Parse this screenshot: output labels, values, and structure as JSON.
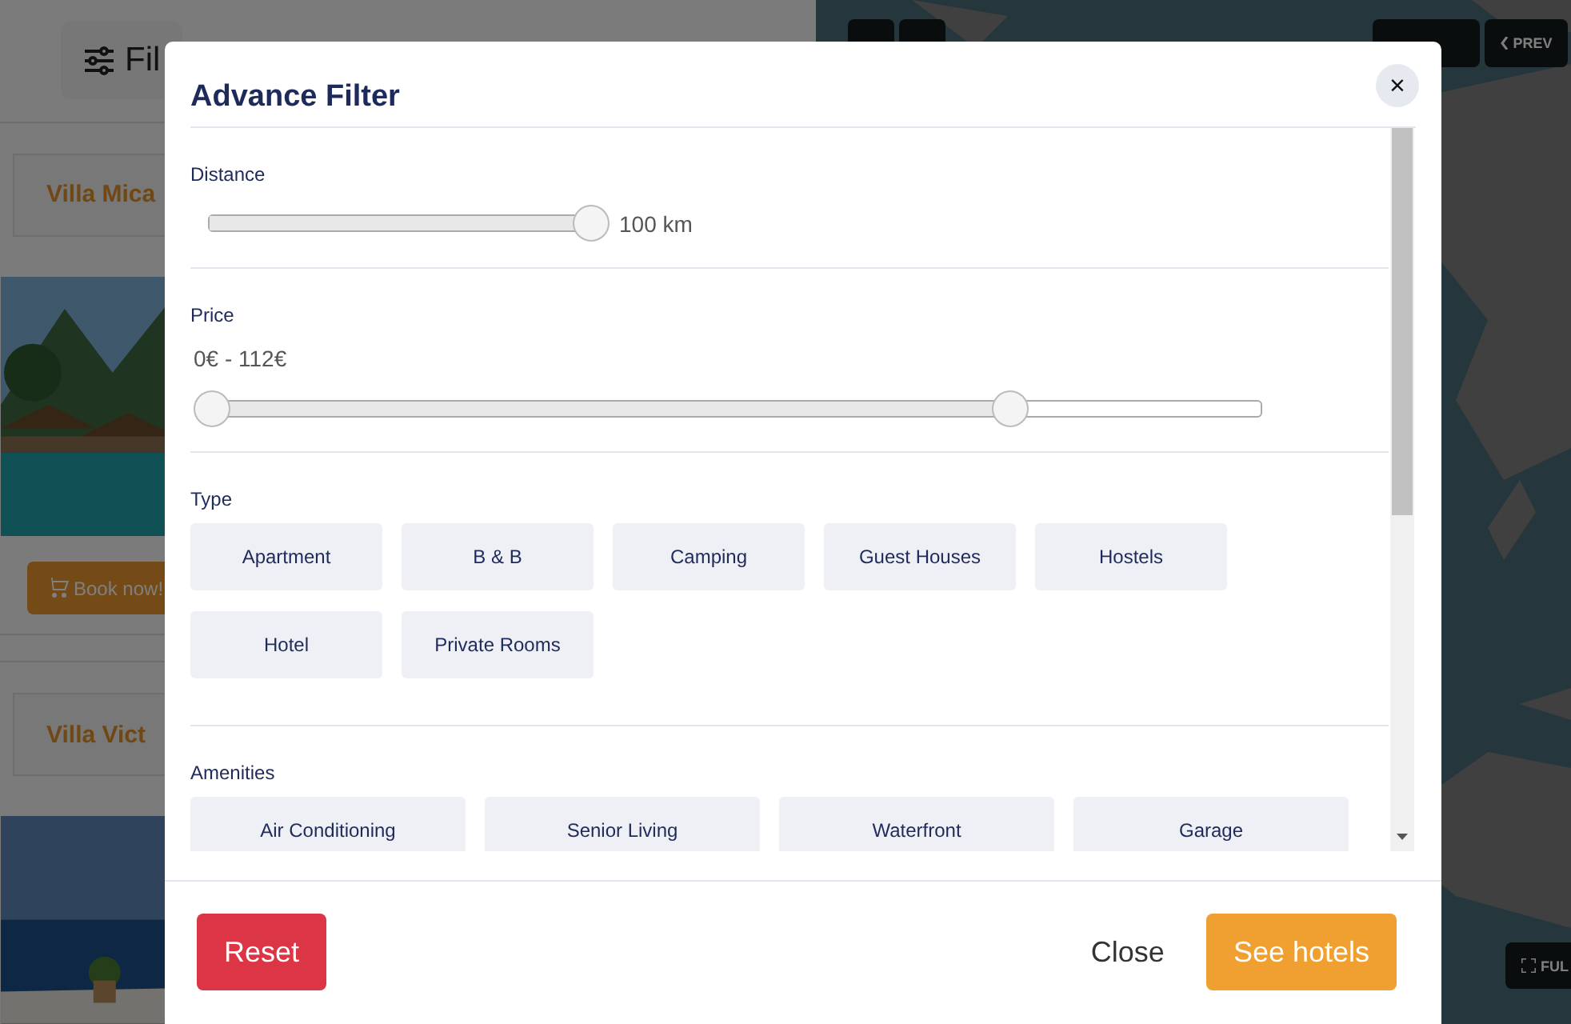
{
  "page": {
    "filter_button": "Fil",
    "listings": [
      {
        "title": "Villa Mica",
        "book_button": "Book now!"
      },
      {
        "title": "Villa Vict"
      }
    ]
  },
  "map": {
    "prev_button": "PREV",
    "fullscreen_button": "FUL"
  },
  "modal": {
    "title": "Advance Filter",
    "close": "×",
    "distance": {
      "label": "Distance",
      "level": 1,
      "reading": "100 km"
    },
    "price": {
      "label": "Price",
      "reading": "0€ - 112€",
      "thumbs": [
        {
          "level": 0
        },
        {
          "level": 0.76
        }
      ]
    },
    "type": {
      "label": "Type",
      "options": [
        {
          "label": "Apartment",
          "selected": false
        },
        {
          "label": "B & B",
          "selected": false
        },
        {
          "label": "Camping",
          "selected": false
        },
        {
          "label": "Guest Houses",
          "selected": false
        },
        {
          "label": "Hostels",
          "selected": false
        },
        {
          "label": "Hotel",
          "selected": false
        },
        {
          "label": "Private Rooms",
          "selected": false
        }
      ]
    },
    "amenities": {
      "label": "Amenities",
      "options": [
        {
          "label": "Air Conditioning",
          "selected": false
        },
        {
          "label": "Senior Living",
          "selected": false
        },
        {
          "label": "Waterfront",
          "selected": false
        },
        {
          "label": "Garage",
          "selected": false
        }
      ]
    },
    "buttons": {
      "reset": "Reset",
      "close": "Close",
      "submit": "See hotels"
    }
  }
}
